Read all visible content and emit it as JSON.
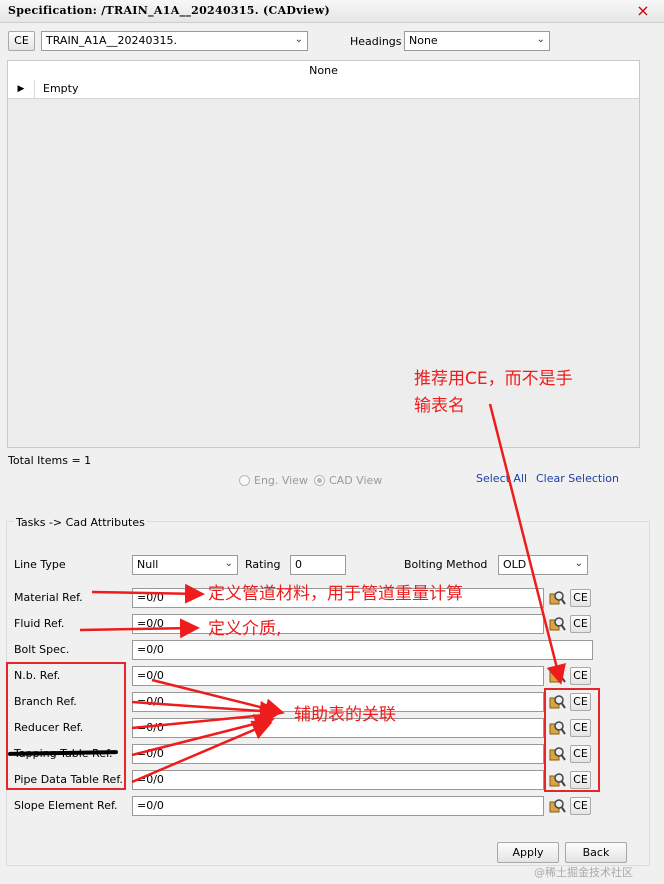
{
  "window": {
    "title": "Specification: /TRAIN_A1A__20240315. (CADview)",
    "close": "×"
  },
  "toolbar": {
    "ce_label": "CE",
    "spec_value": "TRAIN_A1A__20240315.",
    "headings_label": "Headings",
    "headings_value": "None"
  },
  "grid": {
    "header": "None",
    "row_label": "Empty"
  },
  "status": {
    "total_items": "Total Items = 1"
  },
  "view": {
    "eng_view": "Eng. View",
    "cad_view": "CAD View",
    "select_all": "Select All",
    "clear_selection": "Clear Selection"
  },
  "group": {
    "title": "Tasks -> Cad Attributes"
  },
  "attrs": {
    "line_type_label": "Line Type",
    "line_type_value": "Null",
    "rating_label": "Rating",
    "rating_value": "0",
    "bolting_label": "Bolting Method",
    "bolting_value": "OLD",
    "rows": [
      {
        "label": "Material Ref.",
        "value": "=0/0",
        "ce": "CE"
      },
      {
        "label": "Fluid Ref.",
        "value": "=0/0",
        "ce": "CE"
      },
      {
        "label": "Bolt Spec.",
        "value": "=0/0"
      },
      {
        "label": "N.b. Ref.",
        "value": "=0/0",
        "ce": "CE"
      },
      {
        "label": "Branch Ref.",
        "value": "=0/0",
        "ce": "CE"
      },
      {
        "label": "Reducer Ref.",
        "value": "=0/0",
        "ce": "CE"
      },
      {
        "label": "Tapping Table Ref.",
        "value": "=0/0",
        "ce": "CE"
      },
      {
        "label": "Pipe Data Table Ref.",
        "value": "=0/0",
        "ce": "CE"
      },
      {
        "label": "Slope Element Ref.",
        "value": "=0/0",
        "ce": "CE"
      }
    ]
  },
  "buttons": {
    "apply": "Apply",
    "back": "Back"
  },
  "annotations": {
    "recommend_1": "推荐用CE，而不是手",
    "recommend_2": "输表名",
    "material_note": "定义管道材料，用于管道重量计算",
    "fluid_note": "定义介质,",
    "aux_note": "辅助表的关联"
  },
  "watermark": "@稀土掘金技术社区"
}
